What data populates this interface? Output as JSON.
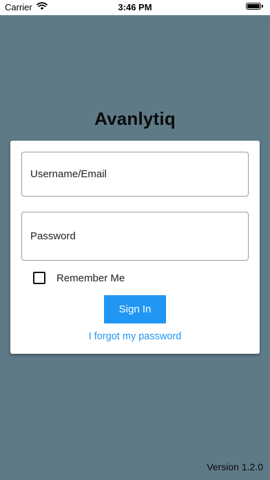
{
  "status_bar": {
    "carrier": "Carrier",
    "time": "3:46 PM",
    "wifi_icon": "wifi-icon",
    "battery_icon": "battery-icon"
  },
  "app": {
    "title": "Avanlytiq"
  },
  "login_form": {
    "username": {
      "placeholder": "Username/Email",
      "value": ""
    },
    "password": {
      "placeholder": "Password",
      "value": ""
    },
    "remember_me": {
      "label": "Remember Me",
      "checked": false
    },
    "sign_in_label": "Sign In",
    "forgot_password_label": "I forgot my password"
  },
  "footer": {
    "version": "Version 1.2.0"
  },
  "colors": {
    "background": "#5f7a87",
    "accent": "#2196f3",
    "card": "#ffffff"
  }
}
